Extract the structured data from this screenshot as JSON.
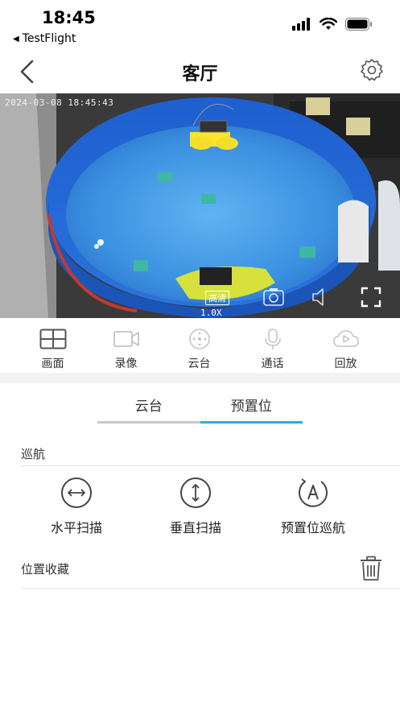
{
  "status_bar": {
    "time": "18:45",
    "back_app": "TestFlight",
    "icons": [
      "signal-icon",
      "wifi-icon",
      "battery-icon"
    ]
  },
  "nav": {
    "title": "客厅",
    "icons": [
      "back-chevron-icon",
      "gear-icon"
    ]
  },
  "camera": {
    "timestamp": "2024-03-08 18:45:43",
    "quality_label": "高清",
    "zoom_label": "1.0X",
    "icons": [
      "snapshot-icon",
      "mute-icon",
      "fullscreen-icon"
    ]
  },
  "toolbar": {
    "items": [
      {
        "label": "画面",
        "icon": "grid-view-icon"
      },
      {
        "label": "录像",
        "icon": "video-camera-icon"
      },
      {
        "label": "云台",
        "icon": "ptz-icon"
      },
      {
        "label": "通话",
        "icon": "microphone-icon"
      },
      {
        "label": "回放",
        "icon": "playback-cloud-icon"
      }
    ]
  },
  "tabs": {
    "items": [
      {
        "label": "云台",
        "active": false
      },
      {
        "label": "预置位",
        "active": true
      }
    ],
    "active_color": "#2bb0d8",
    "inactive_color": "#c8c8c8"
  },
  "cruise": {
    "section_label": "巡航",
    "actions": [
      {
        "label": "水平扫描",
        "icon": "horizontal-arrows-icon"
      },
      {
        "label": "垂直扫描",
        "icon": "vertical-arrows-icon"
      },
      {
        "label": "预置位巡航",
        "icon": "auto-cruise-icon"
      }
    ]
  },
  "favorites": {
    "section_label": "位置收藏",
    "icons": [
      "trash-icon"
    ]
  }
}
